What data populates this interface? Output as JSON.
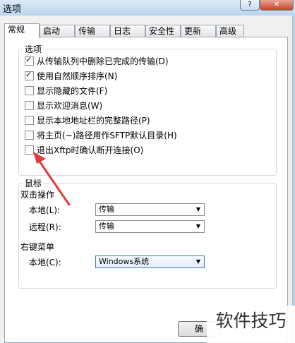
{
  "window": {
    "title": "选项",
    "help_glyph": "?",
    "close_glyph": "✕"
  },
  "tabs": [
    {
      "label": "常规",
      "active": true
    },
    {
      "label": "启动",
      "active": false
    },
    {
      "label": "传输",
      "active": false
    },
    {
      "label": "日志",
      "active": false
    },
    {
      "label": "安全性",
      "active": false
    },
    {
      "label": "更新",
      "active": false
    },
    {
      "label": "高级",
      "active": false
    }
  ],
  "options_group": {
    "title": "选项",
    "items": [
      {
        "label": "从传输队列中删除已完成的传输(D)",
        "checked": true
      },
      {
        "label": "使用自然顺序排序(N)",
        "checked": true
      },
      {
        "label": "显示隐藏的文件(F)",
        "checked": false
      },
      {
        "label": "显示欢迎消息(W)",
        "checked": false
      },
      {
        "label": "显示本地地址栏的完整路径(P)",
        "checked": false
      },
      {
        "label": "将主页(~)路径用作SFTP默认目录(H)",
        "checked": false
      },
      {
        "label": "退出Xftp时确认断开连接(O)",
        "checked": false
      }
    ]
  },
  "mouse_group": {
    "title": "鼠标",
    "double_click_title": "双击操作",
    "local_label": "本地(L):",
    "local_value": "传输",
    "remote_label": "远程(R):",
    "remote_value": "传输",
    "right_menu_title": "右键菜单",
    "right_local_label": "本地(C):",
    "right_local_value": "Windows系统"
  },
  "buttons": {
    "ok_label": "确"
  },
  "watermark": "软件技巧",
  "colors": {
    "arrow": "#e33b3b"
  }
}
